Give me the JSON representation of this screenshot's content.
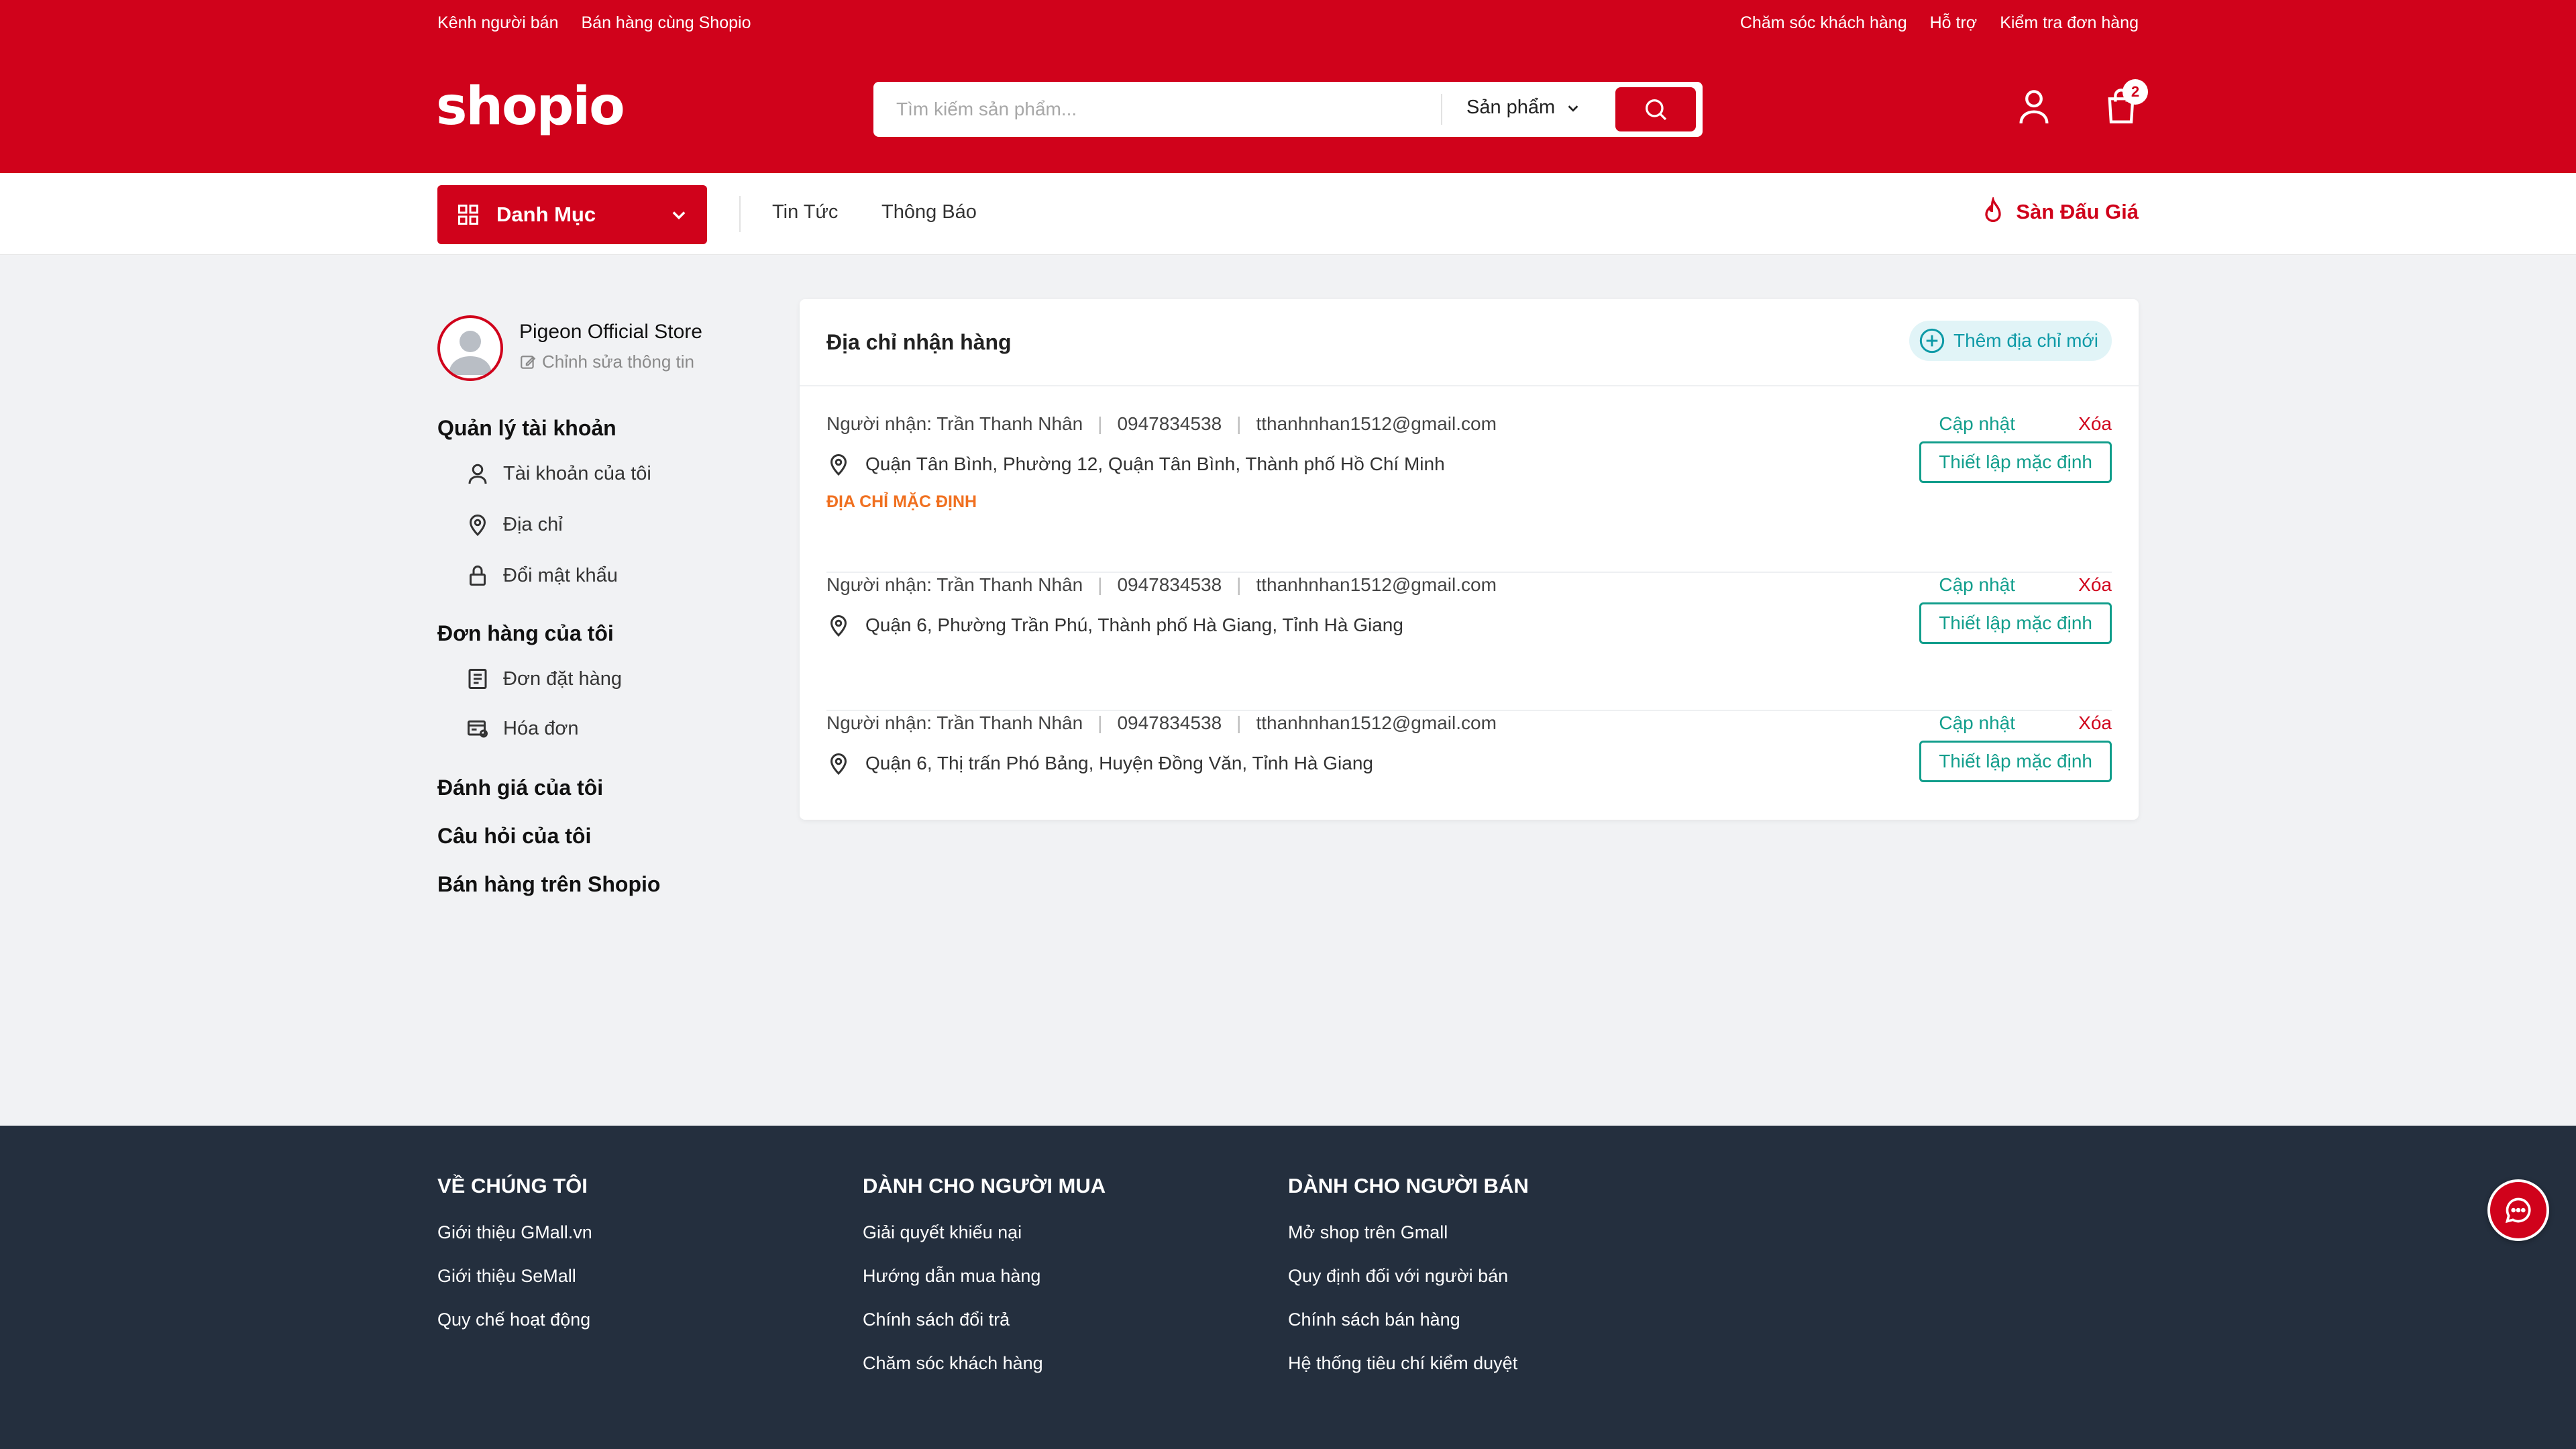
{
  "topbar": {
    "left_links": [
      "Kênh người bán",
      "Bán hàng cùng Shopio"
    ],
    "right_links": [
      "Chăm sóc khách hàng",
      "Hỗ trợ",
      "Kiểm tra đơn hàng"
    ]
  },
  "header": {
    "logo": "shopio",
    "search_placeholder": "Tìm kiếm sản phẩm...",
    "search_type": "Sản phẩm",
    "cart_count": "2",
    "icons": [
      "search-icon",
      "user-icon",
      "cart-icon",
      "chevron-down-icon"
    ]
  },
  "nav": {
    "category_label": "Danh Mục",
    "links": [
      "Tin Tức",
      "Thông Báo"
    ],
    "auction_label": "Sàn Đấu Giá"
  },
  "sidebar": {
    "store_name": "Pigeon Official Store",
    "edit_label": "Chỉnh sửa thông tin",
    "account_heading": "Quản lý tài khoản",
    "account_items": [
      "Tài khoản của tôi",
      "Địa chỉ",
      "Đổi mật khẩu"
    ],
    "orders_heading": "Đơn hàng của tôi",
    "order_items": [
      "Đơn đặt hàng",
      "Hóa đơn"
    ],
    "reviews": "Đánh giá của tôi",
    "questions": "Câu hỏi của tôi",
    "sell": "Bán hàng trên Shopio"
  },
  "address_card": {
    "title": "Địa chỉ nhận hàng",
    "add_label": "Thêm địa chỉ mới",
    "update_label": "Cập nhật",
    "delete_label": "Xóa",
    "set_default_label": "Thiết lập mặc định",
    "default_tag": "ĐỊA CHỈ MẶC ĐỊNH",
    "addresses": [
      {
        "recipient": "Người nhận: Trần Thanh Nhân",
        "phone": "0947834538",
        "email": "tthanhnhan1512@gmail.com",
        "address": "Quận Tân Bình, Phường 12, Quận Tân Bình, Thành phố Hồ Chí Minh",
        "is_default": true
      },
      {
        "recipient": "Người nhận: Trần Thanh Nhân",
        "phone": "0947834538",
        "email": "tthanhnhan1512@gmail.com",
        "address": "Quận 6, Phường Trần Phú, Thành phố Hà Giang, Tỉnh Hà Giang",
        "is_default": false
      },
      {
        "recipient": "Người nhận: Trần Thanh Nhân",
        "phone": "0947834538",
        "email": "tthanhnhan1512@gmail.com",
        "address": "Quận 6, Thị trấn Phó Bảng, Huyện Đồng Văn, Tỉnh Hà Giang",
        "is_default": false
      }
    ]
  },
  "footer": {
    "columns": [
      {
        "title": "VỀ CHÚNG TÔI",
        "links": [
          "Giới thiệu GMall.vn",
          "Giới thiệu SeMall",
          "Quy chế hoạt động"
        ]
      },
      {
        "title": "DÀNH CHO NGƯỜI MUA",
        "links": [
          "Giải quyết khiếu nại",
          "Hướng dẫn mua hàng",
          "Chính sách đổi trả",
          "Chăm sóc khách hàng"
        ]
      },
      {
        "title": "DÀNH CHO NGƯỜI BÁN",
        "links": [
          "Mở shop trên Gmall",
          "Quy định đối với người bán",
          "Chính sách bán hàng",
          "Hệ thống tiêu chí kiểm duyệt"
        ]
      }
    ]
  },
  "colors": {
    "brand": "#d0021b",
    "teal": "#129e8c",
    "default_tag": "#f07020",
    "footer_bg": "#242f3e"
  }
}
